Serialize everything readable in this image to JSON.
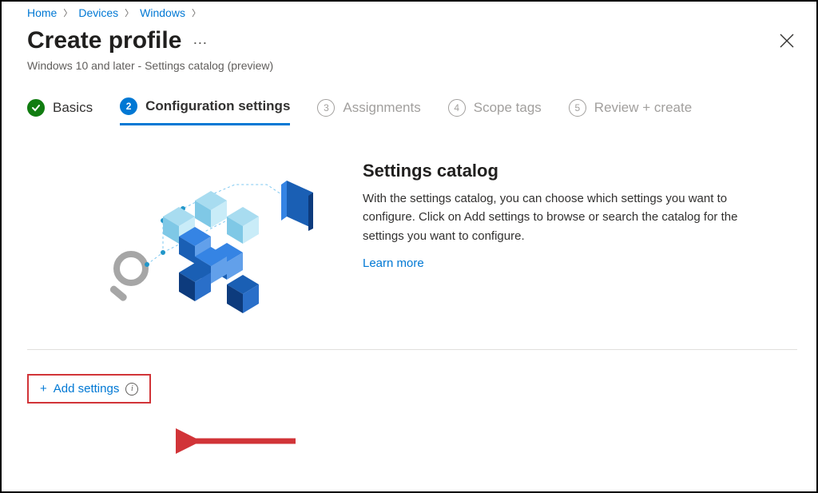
{
  "breadcrumb": [
    {
      "label": "Home"
    },
    {
      "label": "Devices"
    },
    {
      "label": "Windows"
    }
  ],
  "header": {
    "title": "Create profile",
    "subtitle": "Windows 10 and later - Settings catalog (preview)"
  },
  "stepper": {
    "steps": [
      {
        "num": "✓",
        "label": "Basics",
        "state": "done"
      },
      {
        "num": "2",
        "label": "Configuration settings",
        "state": "active"
      },
      {
        "num": "3",
        "label": "Assignments",
        "state": "pending"
      },
      {
        "num": "4",
        "label": "Scope tags",
        "state": "pending"
      },
      {
        "num": "5",
        "label": "Review + create",
        "state": "pending"
      }
    ]
  },
  "hero": {
    "title": "Settings catalog",
    "body": "With the settings catalog, you can choose which settings you want to configure. Click on Add settings to browse or search the catalog for the settings you want to configure.",
    "learn_more": "Learn more"
  },
  "actions": {
    "add_settings": "Add settings"
  },
  "colors": {
    "link": "#0078d4",
    "success": "#107c10",
    "highlight_border": "#d13438",
    "muted": "#605e5c"
  }
}
